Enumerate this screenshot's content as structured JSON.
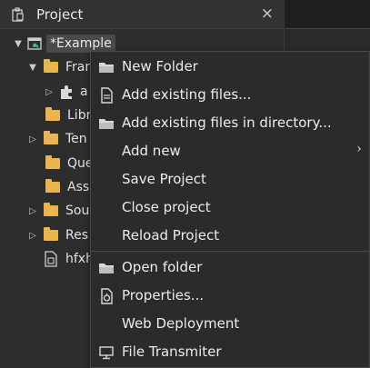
{
  "panel": {
    "title": "Project",
    "close_glyph": "×"
  },
  "tree": {
    "root_label": "*Example",
    "items": [
      {
        "label": "Fran",
        "arrow": "▼",
        "icon": "folder-icon"
      },
      {
        "label": "a",
        "arrow": "▷",
        "icon": "puzzle-icon"
      },
      {
        "label": "Libr",
        "arrow": "",
        "icon": "folder-icon"
      },
      {
        "label": "Ten",
        "arrow": "▷",
        "icon": "folder-icon"
      },
      {
        "label": "Que",
        "arrow": "",
        "icon": "folder-icon"
      },
      {
        "label": "Asse",
        "arrow": "",
        "icon": "folder-icon"
      },
      {
        "label": "Sou",
        "arrow": "▷",
        "icon": "folder-icon"
      },
      {
        "label": "Res",
        "arrow": "▷",
        "icon": "folder-icon"
      },
      {
        "label": "hfxh",
        "arrow": "",
        "icon": "file-icon"
      }
    ]
  },
  "menu": {
    "items": [
      {
        "label": "New Folder",
        "icon": "folder-open-icon"
      },
      {
        "label": "Add existing files...",
        "icon": "document-icon"
      },
      {
        "label": "Add existing files in directory...",
        "icon": "folder-open-icon"
      },
      {
        "label": "Add new",
        "icon": "",
        "submenu": "›"
      },
      {
        "label": "Save Project",
        "icon": ""
      },
      {
        "label": "Close project",
        "icon": ""
      },
      {
        "label": "Reload Project",
        "icon": ""
      },
      {
        "label": "Open folder",
        "icon": "folder-open-icon"
      },
      {
        "label": "Properties...",
        "icon": "properties-icon"
      },
      {
        "label": "Web Deployment",
        "icon": ""
      },
      {
        "label": "File Transmiter",
        "icon": "monitor-icon"
      }
    ]
  },
  "colors": {
    "folder": "#e8b64c",
    "background": "#2d2d2d",
    "menu_bg": "#2b2b2b",
    "text": "#ececec"
  }
}
